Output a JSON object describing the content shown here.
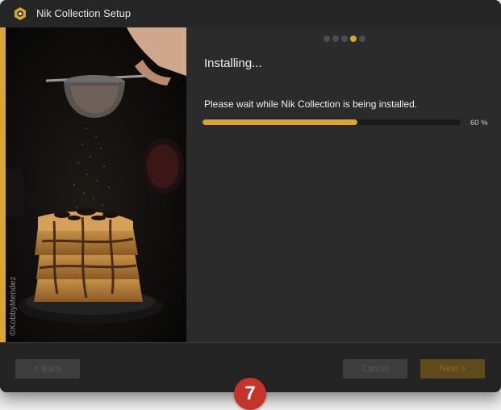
{
  "window": {
    "title": "Nik Collection Setup",
    "app_icon": "nik-collection-logo-icon"
  },
  "left_panel": {
    "photo_credit": "©KobbyMendez",
    "accent_color": "#d9a535"
  },
  "step_indicator": {
    "total_steps": 5,
    "current_step": 4
  },
  "main": {
    "heading": "Installing...",
    "message": "Please wait while Nik Collection is being installed.",
    "progress_fraction": 0.6,
    "progress_label": "60 %"
  },
  "footer": {
    "back_label": "< Back",
    "cancel_label": "Cancel",
    "next_label": "Next >"
  },
  "annotation": {
    "step_number": "7",
    "color": "#c4342b"
  }
}
